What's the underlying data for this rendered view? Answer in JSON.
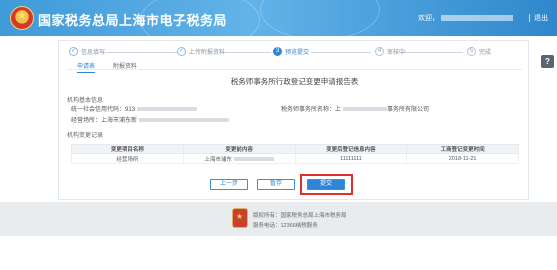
{
  "header": {
    "site_title": "国家税务总局上海市电子税务局",
    "welcome": "欢迎，",
    "logout": "退出"
  },
  "steps": [
    {
      "num": "1",
      "label": "信息填写"
    },
    {
      "num": "2",
      "label": "上传附报资料"
    },
    {
      "num": "3",
      "label": "预览提交"
    },
    {
      "num": "4",
      "label": "审核中"
    },
    {
      "num": "5",
      "label": "完成"
    }
  ],
  "tabs": {
    "report": "申请表",
    "attachments": "附报资料"
  },
  "form": {
    "title": "税务师事务所行政登记变更申请报告表",
    "basic_section": "机构基本信息",
    "credit_code_label": "统一社会信用代码：",
    "credit_code_value": "913",
    "firm_name_label": "税务师事务所名称：",
    "firm_name_value": "上",
    "firm_name_suffix": "事务所有限公司",
    "address_label": "经营场所：",
    "address_value": "上海市浦东新",
    "change_section": "机构变更记录"
  },
  "table": {
    "headers": [
      "变更项目名称",
      "变更前内容",
      "变更后登记信息内容",
      "工商登记变更时间"
    ],
    "rows": [
      {
        "item": "经营场所",
        "before": "上海市浦东",
        "after": "11111111",
        "date": "2018-11-21"
      }
    ]
  },
  "buttons": {
    "prev": "上一步",
    "save": "暂存",
    "submit": "提交"
  },
  "footer": {
    "sponsor": "版权所有：国家税务总局上海市税务局",
    "hotline": "服务电话：12366纳税服务"
  },
  "colors": {
    "accent": "#2f86d6",
    "header": "#3f9ad8",
    "highlight": "#e0322a"
  }
}
